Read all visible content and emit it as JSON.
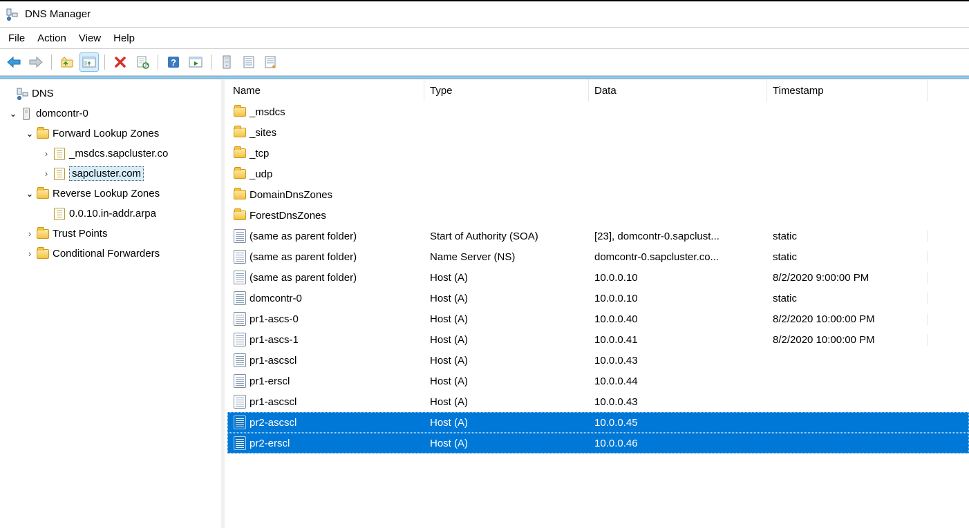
{
  "app": {
    "title": "DNS Manager"
  },
  "menu": {
    "file": "File",
    "action": "Action",
    "view": "View",
    "help": "Help"
  },
  "tree": {
    "root": "DNS",
    "server": "domcontr-0",
    "flz": "Forward Lookup Zones",
    "flz_children": {
      "msdcs": "_msdcs.sapcluster.co",
      "sapcluster": "sapcluster.com"
    },
    "rlz": "Reverse Lookup Zones",
    "rlz_children": {
      "arpa": "0.0.10.in-addr.arpa"
    },
    "trust": "Trust Points",
    "condfwd": "Conditional Forwarders"
  },
  "columns": {
    "name": "Name",
    "type": "Type",
    "data": "Data",
    "ts": "Timestamp"
  },
  "rows": [
    {
      "icon": "folder",
      "name": "_msdcs",
      "type": "",
      "data": "",
      "ts": ""
    },
    {
      "icon": "folder",
      "name": "_sites",
      "type": "",
      "data": "",
      "ts": ""
    },
    {
      "icon": "folder",
      "name": "_tcp",
      "type": "",
      "data": "",
      "ts": ""
    },
    {
      "icon": "folder",
      "name": "_udp",
      "type": "",
      "data": "",
      "ts": ""
    },
    {
      "icon": "folder",
      "name": "DomainDnsZones",
      "type": "",
      "data": "",
      "ts": ""
    },
    {
      "icon": "folder",
      "name": "ForestDnsZones",
      "type": "",
      "data": "",
      "ts": ""
    },
    {
      "icon": "record",
      "name": "(same as parent folder)",
      "type": "Start of Authority (SOA)",
      "data": "[23], domcontr-0.sapclust...",
      "ts": "static"
    },
    {
      "icon": "record",
      "name": "(same as parent folder)",
      "type": "Name Server (NS)",
      "data": "domcontr-0.sapcluster.co...",
      "ts": "static"
    },
    {
      "icon": "record",
      "name": "(same as parent folder)",
      "type": "Host (A)",
      "data": "10.0.0.10",
      "ts": "8/2/2020 9:00:00 PM"
    },
    {
      "icon": "record",
      "name": "domcontr-0",
      "type": "Host (A)",
      "data": "10.0.0.10",
      "ts": "static"
    },
    {
      "icon": "record",
      "name": "pr1-ascs-0",
      "type": "Host (A)",
      "data": "10.0.0.40",
      "ts": "8/2/2020 10:00:00 PM"
    },
    {
      "icon": "record",
      "name": "pr1-ascs-1",
      "type": "Host (A)",
      "data": "10.0.0.41",
      "ts": "8/2/2020 10:00:00 PM"
    },
    {
      "icon": "record",
      "name": "pr1-ascscl",
      "type": "Host (A)",
      "data": "10.0.0.43",
      "ts": ""
    },
    {
      "icon": "record",
      "name": "pr1-erscl",
      "type": "Host (A)",
      "data": "10.0.0.44",
      "ts": ""
    },
    {
      "icon": "record",
      "name": "pr1-ascscl",
      "type": "Host (A)",
      "data": "10.0.0.43",
      "ts": ""
    },
    {
      "icon": "record",
      "name": "pr2-ascscl",
      "type": "Host (A)",
      "data": "10.0.0.45",
      "ts": "",
      "selected": true
    },
    {
      "icon": "record",
      "name": "pr2-erscl",
      "type": "Host (A)",
      "data": "10.0.0.46",
      "ts": "",
      "selected": true
    }
  ]
}
